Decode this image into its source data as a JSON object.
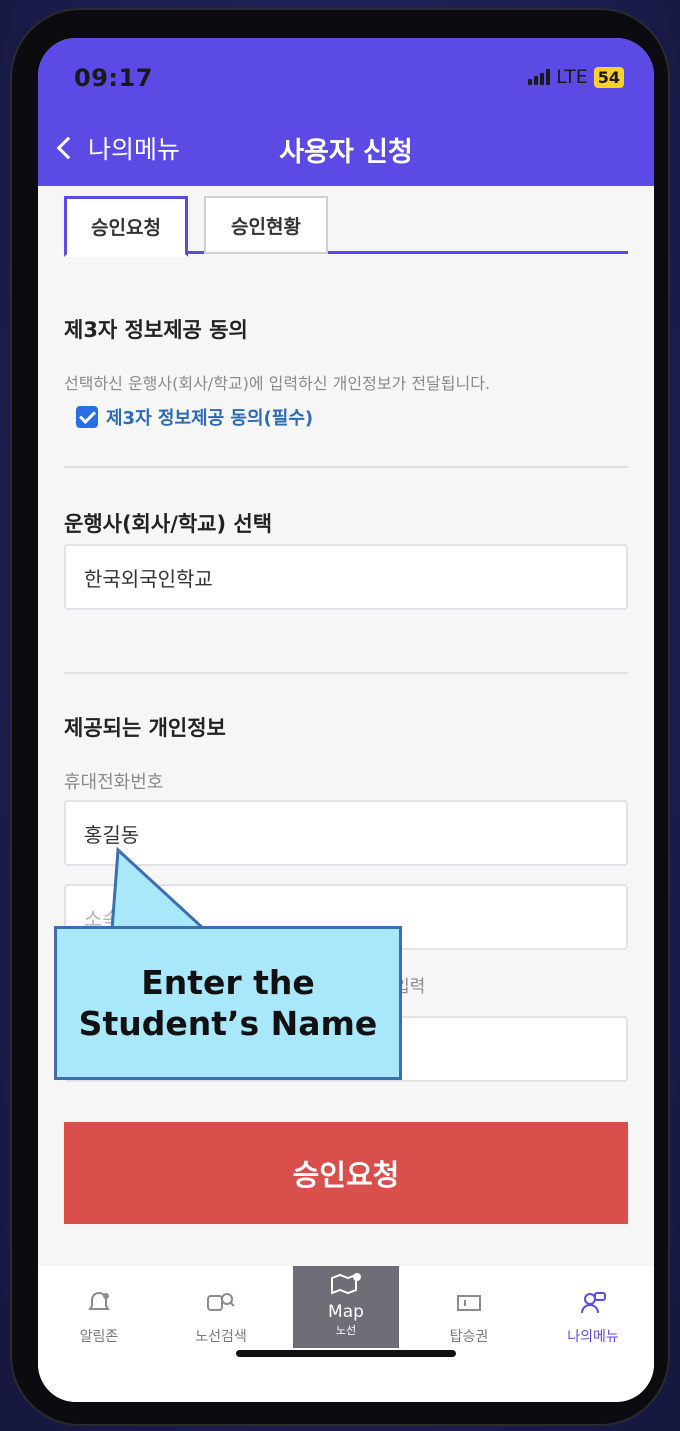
{
  "status": {
    "time": "09:17",
    "network": "LTE",
    "battery": "54"
  },
  "header": {
    "back_label": "나의메뉴",
    "title": "사용자 신청"
  },
  "tabs": [
    {
      "label": "승인요청",
      "active": true
    },
    {
      "label": "승인현황",
      "active": false
    }
  ],
  "consent": {
    "title": "제3자 정보제공 동의",
    "description": "선택하신 운행사(회사/학교)에 입력하신 개인정보가 전달됩니다.",
    "checkbox_label": "제3자 정보제공 동의(필수)",
    "checked": true
  },
  "operator": {
    "title": "운행사(회사/학교) 선택",
    "value": "한국외국인학교"
  },
  "personal": {
    "title": "제공되는 개인정보",
    "phone_label": "휴대전화번호",
    "name_value": "홍길동",
    "affiliation_placeholder": "소속",
    "partial_hint": "입력"
  },
  "submit_label": "승인요청",
  "bottom_nav": [
    {
      "label": "알림존",
      "icon": "bell-icon"
    },
    {
      "label": "노선검색",
      "icon": "bus-search-icon"
    },
    {
      "label": "Map",
      "sub": "노선",
      "icon": "map-icon"
    },
    {
      "label": "탑승권",
      "icon": "ticket-icon"
    },
    {
      "label": "나의메뉴",
      "icon": "user-icon",
      "active": true
    }
  ],
  "callout": {
    "text": "Enter the Student’s Name"
  },
  "colors": {
    "header": "#5c4ae4",
    "submit": "#d94f4c",
    "callout": "#a9e7fb",
    "link": "#2c6ab8"
  }
}
